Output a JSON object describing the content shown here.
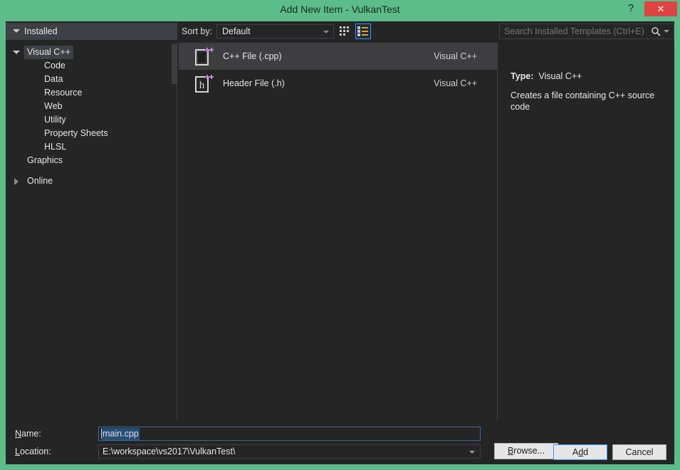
{
  "window": {
    "title": "Add New Item - VulkanTest",
    "help_label": "?",
    "close_label": "✕",
    "accent_green": "#5cbc8a",
    "close_red": "#e04343"
  },
  "toolbar": {
    "installed_label": "Installed",
    "sort_by_label": "Sort by:",
    "sort_by_value": "Default",
    "view_tiles_icon": "tiles-view-icon",
    "view_list_icon": "list-view-icon",
    "search_placeholder": "Search Installed Templates (Ctrl+E)",
    "search_value": "",
    "search_icon": "search-icon"
  },
  "tree": {
    "nodes": [
      {
        "label": "Visual C++",
        "level": 1,
        "expanded": true,
        "selected": true,
        "has_toggle": true
      },
      {
        "label": "Code",
        "level": 2,
        "expanded": false,
        "selected": false,
        "has_toggle": false
      },
      {
        "label": "Data",
        "level": 2,
        "expanded": false,
        "selected": false,
        "has_toggle": false
      },
      {
        "label": "Resource",
        "level": 2,
        "expanded": false,
        "selected": false,
        "has_toggle": false
      },
      {
        "label": "Web",
        "level": 2,
        "expanded": false,
        "selected": false,
        "has_toggle": false
      },
      {
        "label": "Utility",
        "level": 2,
        "expanded": false,
        "selected": false,
        "has_toggle": false
      },
      {
        "label": "Property Sheets",
        "level": 2,
        "expanded": false,
        "selected": false,
        "has_toggle": false
      },
      {
        "label": "HLSL",
        "level": 2,
        "expanded": false,
        "selected": false,
        "has_toggle": false
      },
      {
        "label": "Graphics",
        "level": 1,
        "expanded": false,
        "selected": false,
        "has_toggle": false
      },
      {
        "label": "",
        "level": 1,
        "expanded": false,
        "selected": false,
        "has_toggle": false,
        "spacer": true
      },
      {
        "label": "Online",
        "level": 1,
        "expanded": false,
        "selected": false,
        "has_toggle": true,
        "collapsed": true
      }
    ]
  },
  "templates": {
    "items": [
      {
        "name": "C++ File (.cpp)",
        "origin": "Visual C++",
        "icon": "cpp-file-icon",
        "selected": true
      },
      {
        "name": "Header File (.h)",
        "origin": "Visual C++",
        "icon": "header-file-icon",
        "selected": false
      }
    ]
  },
  "details": {
    "type_key": "Type:",
    "type_value": "Visual C++",
    "description": "Creates a file containing C++ source code"
  },
  "form": {
    "name_label_pre": "",
    "name_label_underline": "N",
    "name_label_post": "ame:",
    "name_value": "main.cpp",
    "location_label_underline": "L",
    "location_label_post": "ocation:",
    "location_value": "E:\\workspace\\vs2017\\VulkanTest\\",
    "browse_underline": "B",
    "browse_post": "rowse...",
    "add_pre": "A",
    "add_underline": "d",
    "add_post": "d",
    "cancel_label": "Cancel"
  }
}
